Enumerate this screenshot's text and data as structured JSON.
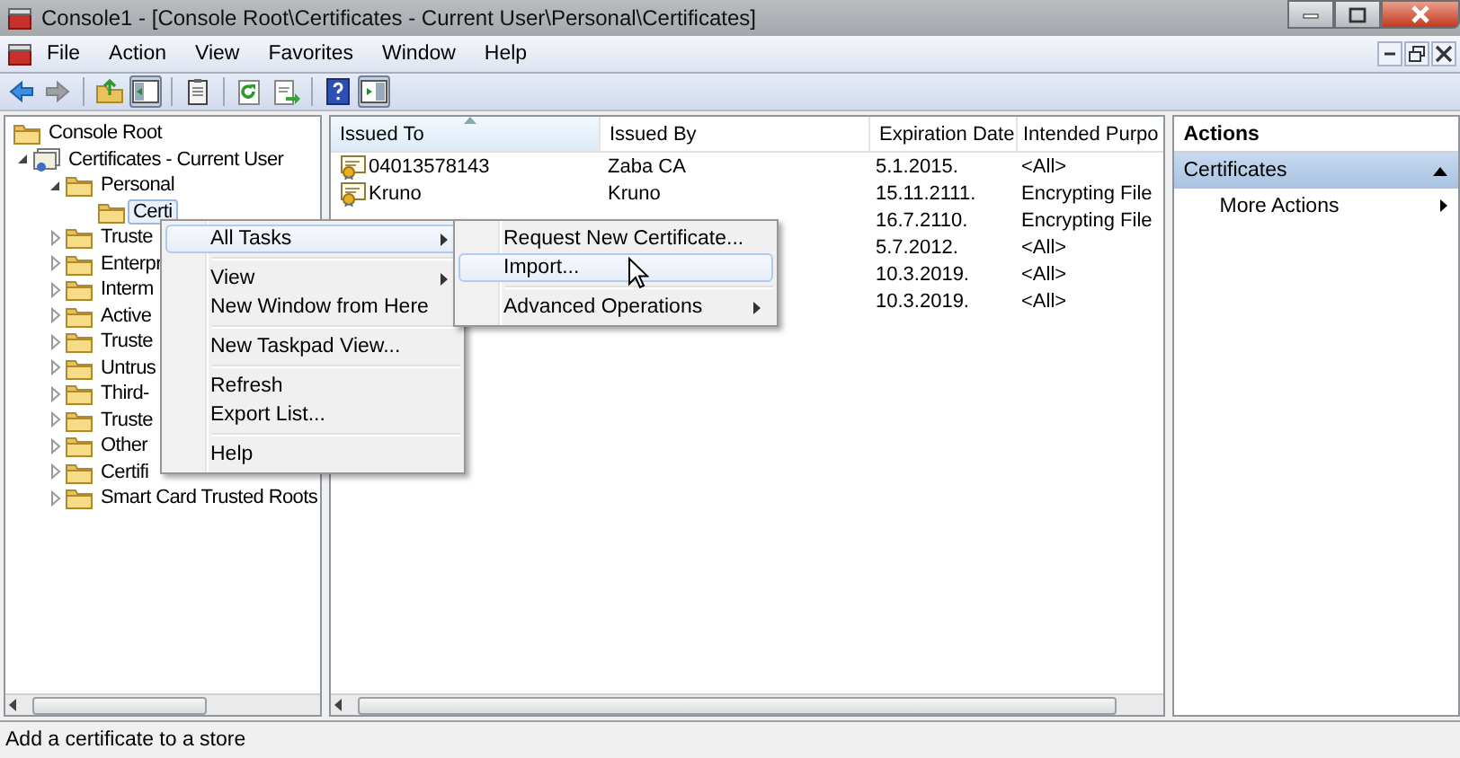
{
  "window": {
    "title": "Console1 - [Console Root\\Certificates - Current User\\Personal\\Certificates]"
  },
  "menu_bar": [
    "File",
    "Action",
    "View",
    "Favorites",
    "Window",
    "Help"
  ],
  "toolbar": [
    {
      "kind": "back",
      "disabled": false,
      "pressed": false
    },
    {
      "kind": "forward",
      "disabled": true,
      "pressed": false
    },
    {
      "kind": "sep"
    },
    {
      "kind": "up",
      "disabled": false,
      "pressed": false
    },
    {
      "kind": "tree",
      "disabled": false,
      "pressed": true
    },
    {
      "kind": "sep"
    },
    {
      "kind": "clipboard",
      "disabled": false,
      "pressed": false
    },
    {
      "kind": "sep"
    },
    {
      "kind": "refresh",
      "disabled": false,
      "pressed": false
    },
    {
      "kind": "export",
      "disabled": false,
      "pressed": false
    },
    {
      "kind": "sep"
    },
    {
      "kind": "help",
      "disabled": false,
      "pressed": false
    },
    {
      "kind": "actionpane",
      "disabled": false,
      "pressed": true
    }
  ],
  "tree": [
    {
      "label": "Console Root",
      "kind": "folder",
      "selected": false,
      "children": [
        {
          "label": "Certificates - Current User",
          "kind": "store",
          "expanded": true,
          "selected": false,
          "children": [
            {
              "label": "Personal",
              "kind": "folder",
              "expanded": true,
              "selected": false,
              "children": [
                {
                  "label": "Certi",
                  "kind": "folder",
                  "selected": true
                }
              ]
            },
            {
              "label": "Truste",
              "kind": "folder",
              "expanded": false,
              "selected": false
            },
            {
              "label": "Enterpr",
              "kind": "folder",
              "expanded": false,
              "selected": false
            },
            {
              "label": "Interm",
              "kind": "folder",
              "expanded": false,
              "selected": false
            },
            {
              "label": "Active",
              "kind": "folder",
              "expanded": false,
              "selected": false
            },
            {
              "label": "Truste",
              "kind": "folder",
              "expanded": false,
              "selected": false
            },
            {
              "label": "Untrus",
              "kind": "folder",
              "expanded": false,
              "selected": false
            },
            {
              "label": "Third-",
              "kind": "folder",
              "expanded": false,
              "selected": false
            },
            {
              "label": "Truste",
              "kind": "folder",
              "expanded": false,
              "selected": false
            },
            {
              "label": "Other",
              "kind": "folder",
              "expanded": false,
              "selected": false
            },
            {
              "label": "Certifi",
              "kind": "folder",
              "expanded": false,
              "selected": false
            },
            {
              "label": "Smart Card Trusted Roots",
              "kind": "folder",
              "expanded": false,
              "selected": false
            }
          ]
        }
      ]
    }
  ],
  "table": {
    "columns": [
      {
        "label": "Issued To",
        "sorted": true
      },
      {
        "label": "Issued By",
        "sorted": false
      },
      {
        "label": "Expiration Date",
        "sorted": false
      },
      {
        "label": "Intended Purpo",
        "sorted": false
      }
    ],
    "rows": [
      {
        "cells": [
          "04013578143",
          "Zaba CA",
          "5.1.2015.",
          "<All>"
        ]
      },
      {
        "cells": [
          "Kruno",
          "Kruno",
          "15.11.2111.",
          "Encrypting File"
        ]
      },
      {
        "cells": [
          "",
          "",
          "16.7.2110.",
          "Encrypting File"
        ]
      },
      {
        "cells": [
          "",
          "",
          "5.7.2012.",
          "<All>"
        ]
      },
      {
        "cells": [
          "",
          "",
          "10.3.2019.",
          "<All>"
        ]
      },
      {
        "cells": [
          "",
          "",
          "10.3.2019.",
          "<All>"
        ]
      }
    ]
  },
  "actions": {
    "title": "Actions",
    "section": "Certificates",
    "items": [
      {
        "label": "More Actions"
      }
    ]
  },
  "context_menu": [
    {
      "kind": "item",
      "label": "All Tasks",
      "submenu": true,
      "selected": true
    },
    {
      "kind": "separator"
    },
    {
      "kind": "item",
      "label": "View",
      "submenu": true,
      "selected": false
    },
    {
      "kind": "item",
      "label": "New Window from Here",
      "submenu": false,
      "selected": false
    },
    {
      "kind": "separator"
    },
    {
      "kind": "item",
      "label": "New Taskpad View...",
      "submenu": false,
      "selected": false
    },
    {
      "kind": "separator"
    },
    {
      "kind": "item",
      "label": "Refresh",
      "submenu": false,
      "selected": false
    },
    {
      "kind": "item",
      "label": "Export List...",
      "submenu": false,
      "selected": false
    },
    {
      "kind": "separator"
    },
    {
      "kind": "item",
      "label": "Help",
      "submenu": false,
      "selected": false
    }
  ],
  "submenu": [
    {
      "kind": "item",
      "label": "Request New Certificate...",
      "submenu": false,
      "selected": false
    },
    {
      "kind": "item",
      "label": "Import...",
      "submenu": false,
      "selected": true
    },
    {
      "kind": "separator"
    },
    {
      "kind": "item",
      "label": "Advanced Operations",
      "submenu": true,
      "selected": false
    }
  ],
  "status_bar": "Add a certificate to a store"
}
